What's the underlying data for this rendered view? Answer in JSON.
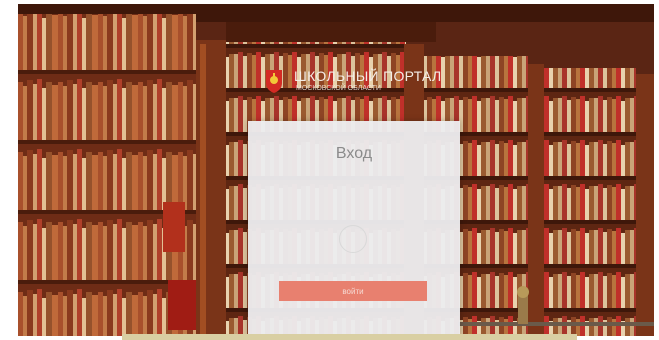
{
  "portal": {
    "title": "ШКОЛЬНЫЙ ПОРТАЛ",
    "subtitle": "МОСКОВСКОЙ ОБЛАСТИ",
    "logo_icon": "coat-of-arms-icon"
  },
  "login": {
    "title": "Вход",
    "button_label": "войти",
    "loading_icon": "spinner-icon"
  },
  "colors": {
    "button": "#e8806f",
    "panel": "#ececee",
    "wood": "#5a2514"
  }
}
